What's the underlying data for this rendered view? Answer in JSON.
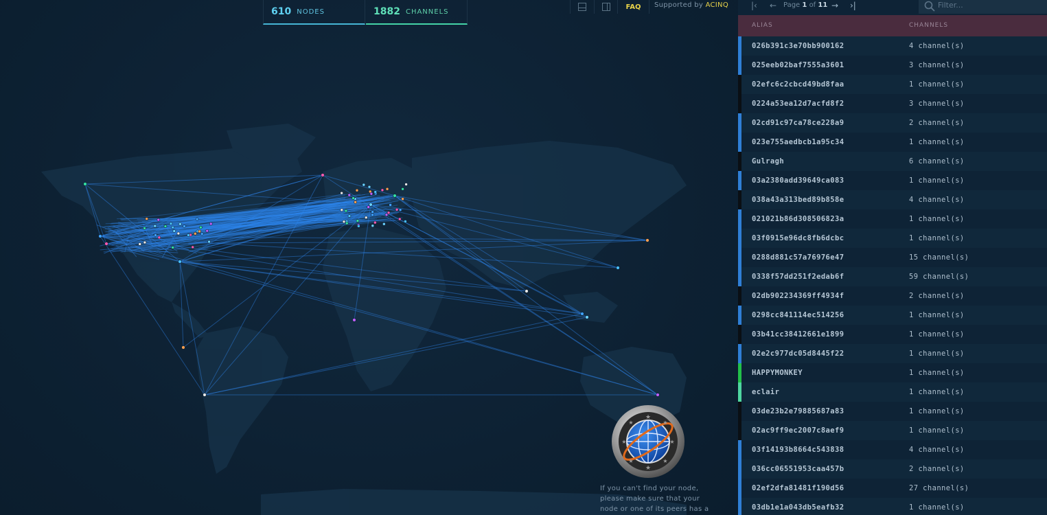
{
  "header": {
    "nodes_count": "610",
    "nodes_label": "NODES",
    "channels_count": "1882",
    "channels_label": "CHANNELS",
    "faq_label": "FAQ",
    "supported_prefix": "Supported by",
    "supported_brand": "ACINQ",
    "accent_nodes": "#5fd0f0",
    "accent_channels": "#5fe0b8",
    "accent_brand": "#e8d24a"
  },
  "pager": {
    "page_word": "Page",
    "current": "1",
    "of_word": "of",
    "total": "11",
    "first_icon": "first-page-icon",
    "prev_icon": "arrow-left-icon",
    "next_icon": "arrow-right-icon",
    "last_icon": "last-page-icon"
  },
  "filter": {
    "placeholder": "Filter..."
  },
  "table": {
    "headers": {
      "alias": "ALIAS",
      "channels": "CHANNELS"
    },
    "rows": [
      {
        "alias": "026b391c3e70bb900162",
        "channels": "4 channel(s)",
        "color": "#2f7fd6"
      },
      {
        "alias": "025eeb02baf7555a3601",
        "channels": "3 channel(s)",
        "color": "#2f7fd6"
      },
      {
        "alias": "02efc6c2cbcd49bd8faa",
        "channels": "1 channel(s)",
        "color": "#0a0f14"
      },
      {
        "alias": "0224a53ea12d7acfd8f2",
        "channels": "3 channel(s)",
        "color": "#0a0f14"
      },
      {
        "alias": "02cd91c97ca78ce228a9",
        "channels": "2 channel(s)",
        "color": "#2f7fd6"
      },
      {
        "alias": "023e755aedbcb1a95c34",
        "channels": "1 channel(s)",
        "color": "#2f7fd6"
      },
      {
        "alias": "Gulragh",
        "channels": "6 channel(s)",
        "color": "#0a0f14"
      },
      {
        "alias": "03a2380add39649ca083",
        "channels": "1 channel(s)",
        "color": "#2f7fd6"
      },
      {
        "alias": "038a43a313bed89b858e",
        "channels": "4 channel(s)",
        "color": "#0a0f14"
      },
      {
        "alias": "021021b86d308506823a",
        "channels": "1 channel(s)",
        "color": "#2f7fd6"
      },
      {
        "alias": "03f0915e96dc8fb6dcbc",
        "channels": "1 channel(s)",
        "color": "#2f7fd6"
      },
      {
        "alias": "0288d881c57a76976e47",
        "channels": "15 channel(s)",
        "color": "#2f7fd6"
      },
      {
        "alias": "0338f57dd251f2edab6f",
        "channels": "59 channel(s)",
        "color": "#2f7fd6"
      },
      {
        "alias": "02db902234369ff4934f",
        "channels": "2 channel(s)",
        "color": "#0a0f14"
      },
      {
        "alias": "0298cc841114ec514256",
        "channels": "1 channel(s)",
        "color": "#2f7fd6"
      },
      {
        "alias": "03b41cc38412661e1899",
        "channels": "1 channel(s)",
        "color": "#0a0f14"
      },
      {
        "alias": "02e2c977dc05d8445f22",
        "channels": "1 channel(s)",
        "color": "#2f7fd6"
      },
      {
        "alias": "HAPPYMONKEY",
        "channels": "1 channel(s)",
        "color": "#22c04a"
      },
      {
        "alias": "eclair",
        "channels": "1 channel(s)",
        "color": "#4fd6a0"
      },
      {
        "alias": "03de23b2e79885687a83",
        "channels": "1 channel(s)",
        "color": "#0a0f14"
      },
      {
        "alias": "02ac9ff9ec2007c8aef9",
        "channels": "1 channel(s)",
        "color": "#0a0f14"
      },
      {
        "alias": "03f14193b8664c543838",
        "channels": "4 channel(s)",
        "color": "#2f7fd6"
      },
      {
        "alias": "036cc06551953caa457b",
        "channels": "2 channel(s)",
        "color": "#2f7fd6"
      },
      {
        "alias": "02ef2dfa81481f190d56",
        "channels": "27 channel(s)",
        "color": "#2f7fd6"
      },
      {
        "alias": "03db1e1a043db5eafb32",
        "channels": "1 channel(s)",
        "color": "#2f7fd6"
      }
    ]
  },
  "message": {
    "lines": [
      "If you can't find your node,",
      "please make sure that your",
      "node or one of its peers has a"
    ]
  },
  "icons": {
    "layout_bottom": "layout-bottom-icon",
    "layout_side": "layout-side-icon",
    "search": "search-icon",
    "badge": "globe-badge-icon"
  },
  "colors": {
    "background": "#0e2336",
    "channel_line": "#2f86ee",
    "header_row": "#4a2c3e"
  }
}
